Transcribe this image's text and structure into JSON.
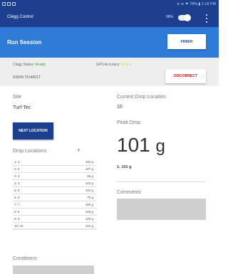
{
  "status_bar": {
    "right_text": "≋ ≋ ⚑ 78% ▮ 1:18 PM"
  },
  "app_bar": {
    "title": "Clegg Control",
    "bt_percent": "96%",
    "toggle_on": true
  },
  "run_bar": {
    "title": "Run Session",
    "finish_label": "FINISH"
  },
  "status_panel": {
    "clegg_status_label": "Clegg Status:",
    "clegg_status_value": "Ready",
    "gps_label": "GPS Accuracy:",
    "gps_value": "±2.4 m",
    "serial": "SS049 7514501T",
    "disconnect_label": "DISCONNECT",
    "colors": {
      "ready": "#3ba33b",
      "gps": "#f0d21d",
      "disconnect": "#d01c1c"
    }
  },
  "left": {
    "site_label": "Site",
    "site_value": "Turf-Tec",
    "next_location_label": "NEXT LOCATION",
    "drop_locations_label": "Drop Locations",
    "add_symbol": "+",
    "drops": [
      {
        "n": "1: 1",
        "v": "104 g"
      },
      {
        "n": "2: 2",
        "v": "107 g"
      },
      {
        "n": "3: 3",
        "v": "95 g"
      },
      {
        "n": "4: 4",
        "v": "104 g"
      },
      {
        "n": "5: 5",
        "v": "104 g"
      },
      {
        "n": "6: 6",
        "v": "75 g"
      },
      {
        "n": "7: 7",
        "v": "100 g"
      },
      {
        "n": "8: 8",
        "v": "103 g"
      },
      {
        "n": "9: 9",
        "v": "100 g"
      },
      {
        "n": "10: 10",
        "v": "101 g"
      }
    ],
    "conditions_label": "Conditions"
  },
  "right": {
    "current_label": "Current Drop Location",
    "current_value": "10",
    "peak_label": "Peak Drop",
    "peak_value": "101",
    "peak_unit": "g",
    "drop_line": "1: 101 g",
    "comments_label": "Comments"
  }
}
